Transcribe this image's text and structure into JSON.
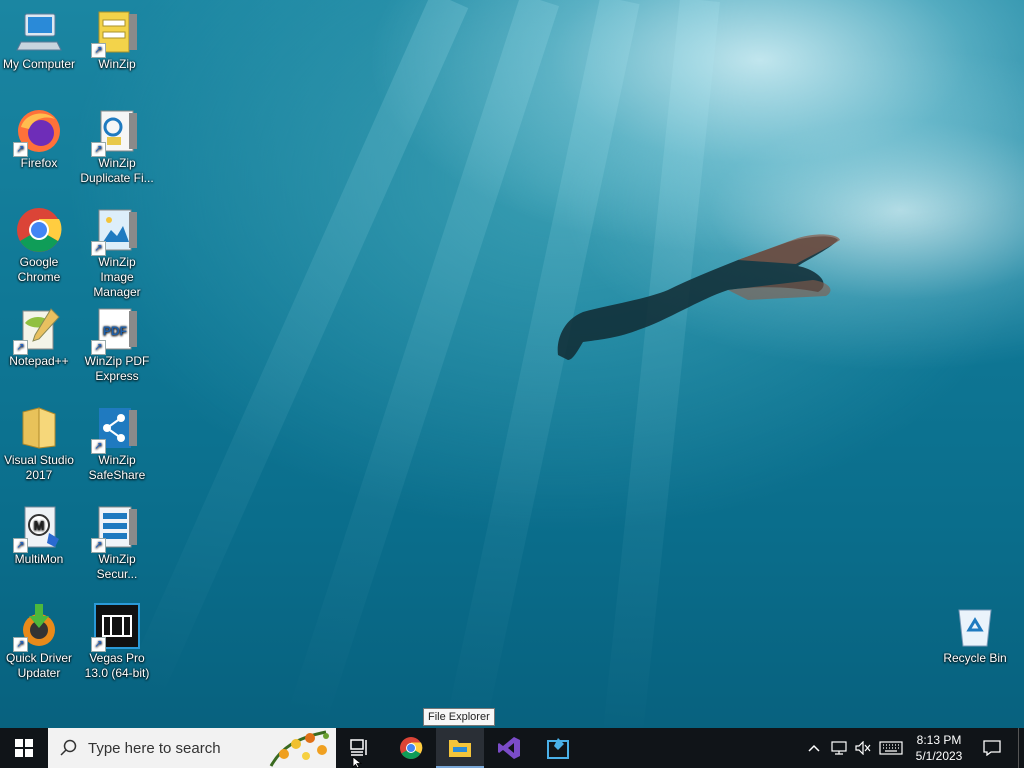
{
  "desktop": {
    "icons_col1": [
      {
        "label": "My Computer",
        "icon": "computer-icon"
      },
      {
        "label": "Firefox",
        "icon": "firefox-icon"
      },
      {
        "label": "Google Chrome",
        "icon": "chrome-icon"
      },
      {
        "label": "Notepad++",
        "icon": "notepad-plus-plus-icon"
      },
      {
        "label": "Visual Studio 2017",
        "icon": "folder-icon"
      },
      {
        "label": "MultiMon",
        "icon": "multimon-icon"
      },
      {
        "label": "Quick Driver Updater",
        "icon": "driver-updater-icon"
      }
    ],
    "icons_col2": [
      {
        "label": "WinZip",
        "icon": "winzip-icon"
      },
      {
        "label": "WinZip Duplicate Fi...",
        "icon": "winzip-duplicate-icon"
      },
      {
        "label": "WinZip Image Manager",
        "icon": "winzip-image-icon"
      },
      {
        "label": "WinZip PDF Express",
        "icon": "winzip-pdf-icon"
      },
      {
        "label": "WinZip SafeShare",
        "icon": "winzip-safeshare-icon"
      },
      {
        "label": "WinZip Secur...",
        "icon": "winzip-secure-icon"
      },
      {
        "label": "Vegas Pro 13.0 (64-bit)",
        "icon": "vegas-pro-icon"
      }
    ],
    "recycle_bin": {
      "label": "Recycle Bin",
      "icon": "recycle-bin-icon"
    }
  },
  "tooltip": {
    "text": "File Explorer"
  },
  "taskbar": {
    "search_placeholder": "Type here to search",
    "pinned": [
      "task-view-icon",
      "chrome-icon",
      "file-explorer-icon",
      "visual-studio-icon",
      "vs-installer-icon"
    ],
    "clock": {
      "time": "8:13 PM",
      "date": "5/1/2023"
    }
  },
  "colors": {
    "taskbar": "#101418",
    "accent": "#0078d7"
  }
}
